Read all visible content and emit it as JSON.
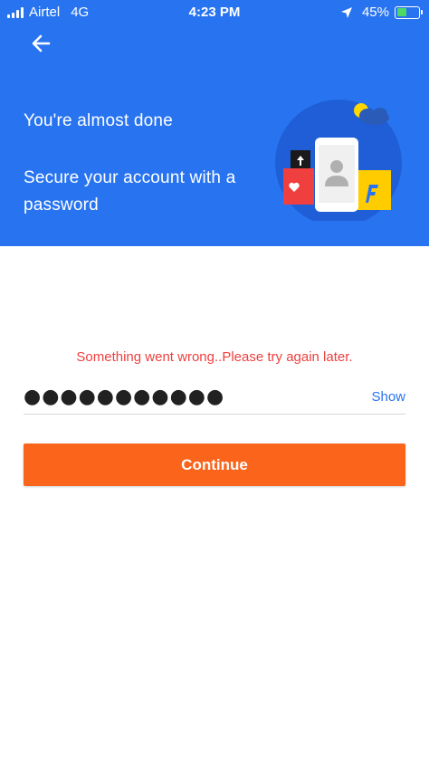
{
  "status_bar": {
    "carrier": "Airtel",
    "network": "4G",
    "time": "4:23 PM",
    "battery_percent": "45%",
    "battery_level": 0.45,
    "icons": [
      "signal-icon",
      "location-arrow-icon",
      "battery-icon"
    ]
  },
  "header": {
    "back_icon": "arrow-left-icon",
    "title": "You're almost done",
    "subtitle": "Secure your account with a password",
    "background_color": "#2874f0"
  },
  "form": {
    "error_message": "Something went wrong..Please try again later.",
    "password_value": "●●●●●●●●●●●",
    "show_label": "Show",
    "continue_label": "Continue",
    "error_color": "#ef3f3f",
    "button_color": "#fb641b",
    "link_color": "#2874f0"
  }
}
